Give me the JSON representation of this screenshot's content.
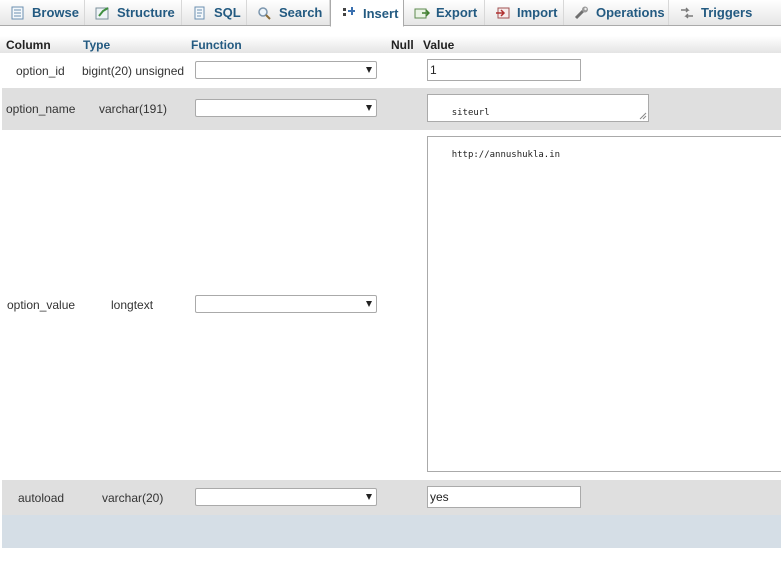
{
  "tabs": [
    {
      "label": "Browse",
      "icon": "browse-icon"
    },
    {
      "label": "Structure",
      "icon": "structure-icon"
    },
    {
      "label": "SQL",
      "icon": "sql-icon"
    },
    {
      "label": "Search",
      "icon": "search-icon"
    },
    {
      "label": "Insert",
      "icon": "insert-icon",
      "active": true
    },
    {
      "label": "Export",
      "icon": "export-icon"
    },
    {
      "label": "Import",
      "icon": "import-icon"
    },
    {
      "label": "Operations",
      "icon": "operations-icon"
    },
    {
      "label": "Triggers",
      "icon": "triggers-icon"
    }
  ],
  "header": {
    "column": "Column",
    "type": "Type",
    "function": "Function",
    "null": "Null",
    "value": "Value"
  },
  "rows": [
    {
      "column": "option_id",
      "type": "bigint(20) unsigned",
      "function": "",
      "value": "1"
    },
    {
      "column": "option_name",
      "type": "varchar(191)",
      "function": "",
      "value": "siteurl"
    },
    {
      "column": "option_value",
      "type": "longtext",
      "function": "",
      "value": "http://annushukla.in"
    },
    {
      "column": "autoload",
      "type": "varchar(20)",
      "function": "",
      "value": "yes"
    }
  ],
  "colors": {
    "link": "#235a81",
    "row_alt": "#dfdfdf",
    "footer": "#d5dee6"
  }
}
